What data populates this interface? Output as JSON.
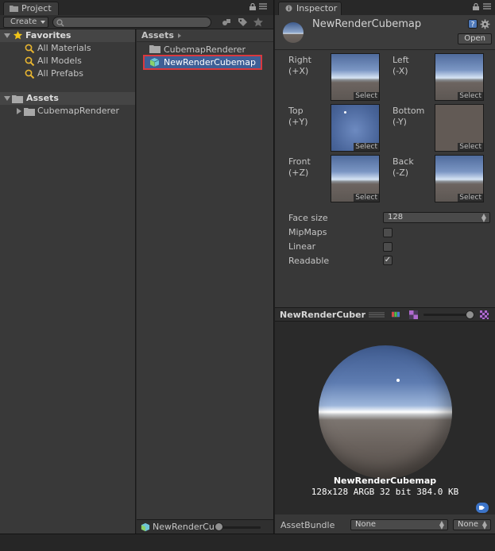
{
  "project": {
    "tab_label": "Project",
    "toolbar": {
      "create_label": "Create"
    },
    "favorites": {
      "header": "Favorites",
      "items": [
        {
          "label": "All Materials"
        },
        {
          "label": "All Models"
        },
        {
          "label": "All Prefabs"
        }
      ]
    },
    "assets_tree": {
      "header": "Assets",
      "items": [
        {
          "label": "CubemapRenderer"
        }
      ]
    },
    "breadcrumb": "Assets",
    "grid_items": [
      {
        "label": "CubemapRenderer",
        "icon": "folder-icon"
      },
      {
        "label": "NewRenderCubemap",
        "icon": "cubemap-icon",
        "selected": true
      }
    ],
    "status_name": "NewRenderCu",
    "selected_outline_color": "#d9393f",
    "selection_color": "#3e5f96"
  },
  "inspector": {
    "tab_label": "Inspector",
    "title": "NewRenderCubemap",
    "open_label": "Open",
    "faces": [
      {
        "name": "Right",
        "axis": "(+X)",
        "select": "Select"
      },
      {
        "name": "Left",
        "axis": "(-X)",
        "select": "Select"
      },
      {
        "name": "Top",
        "axis": "(+Y)",
        "select": "Select"
      },
      {
        "name": "Bottom",
        "axis": "(-Y)",
        "select": "Select"
      },
      {
        "name": "Front",
        "axis": "(+Z)",
        "select": "Select"
      },
      {
        "name": "Back",
        "axis": "(-Z)",
        "select": "Select"
      }
    ],
    "properties": {
      "face_size_label": "Face size",
      "face_size_value": "128",
      "mipmaps_label": "MipMaps",
      "mipmaps_checked": false,
      "linear_label": "Linear",
      "linear_checked": false,
      "readable_label": "Readable",
      "readable_checked": true,
      "check_mark": "✓"
    },
    "preview": {
      "bar_name": "NewRenderCuber",
      "title": "NewRenderCubemap",
      "info": "128x128  ARGB 32 bit  384.0 KB"
    },
    "assetbundle": {
      "label": "AssetBundle",
      "value": "None",
      "variant": "None"
    }
  }
}
